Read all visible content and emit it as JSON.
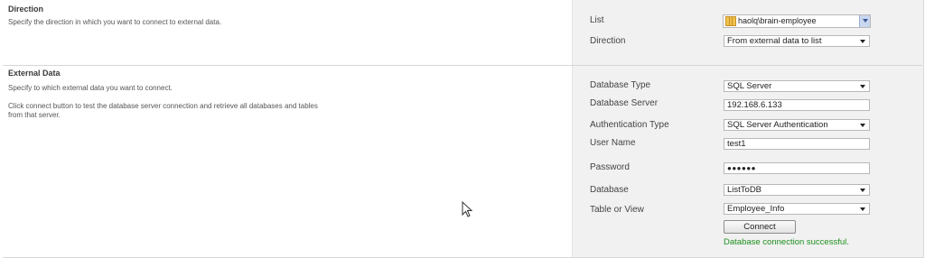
{
  "direction": {
    "title": "Direction",
    "description": "Specify the direction in which you want to connect to external data.",
    "list_label": "List",
    "list_value": "haolq\\brain-employee",
    "direction_label": "Direction",
    "direction_value": "From external data to list"
  },
  "external": {
    "title": "External Data",
    "description": "Specify to which external data you want to connect.",
    "help1": "Click connect button to test the database server connection and retrieve all databases and tables",
    "help2": "from that server.",
    "fields": {
      "db_type_label": "Database Type",
      "db_type_value": "SQL Server",
      "db_server_label": "Database Server",
      "db_server_value": "192.168.6.133",
      "auth_label": "Authentication Type",
      "auth_value": "SQL Server Authentication",
      "user_label": "User Name",
      "user_value": "test1",
      "password_label": "Password",
      "password_value": "●●●●●●",
      "database_label": "Database",
      "database_value": "ListToDB",
      "table_label": "Table or View",
      "table_value": "Employee_Info"
    },
    "connect_label": "Connect",
    "status": "Database connection successful."
  },
  "colors": {
    "panel_bg": "#f1f1f1",
    "success": "#1d8f1d"
  }
}
